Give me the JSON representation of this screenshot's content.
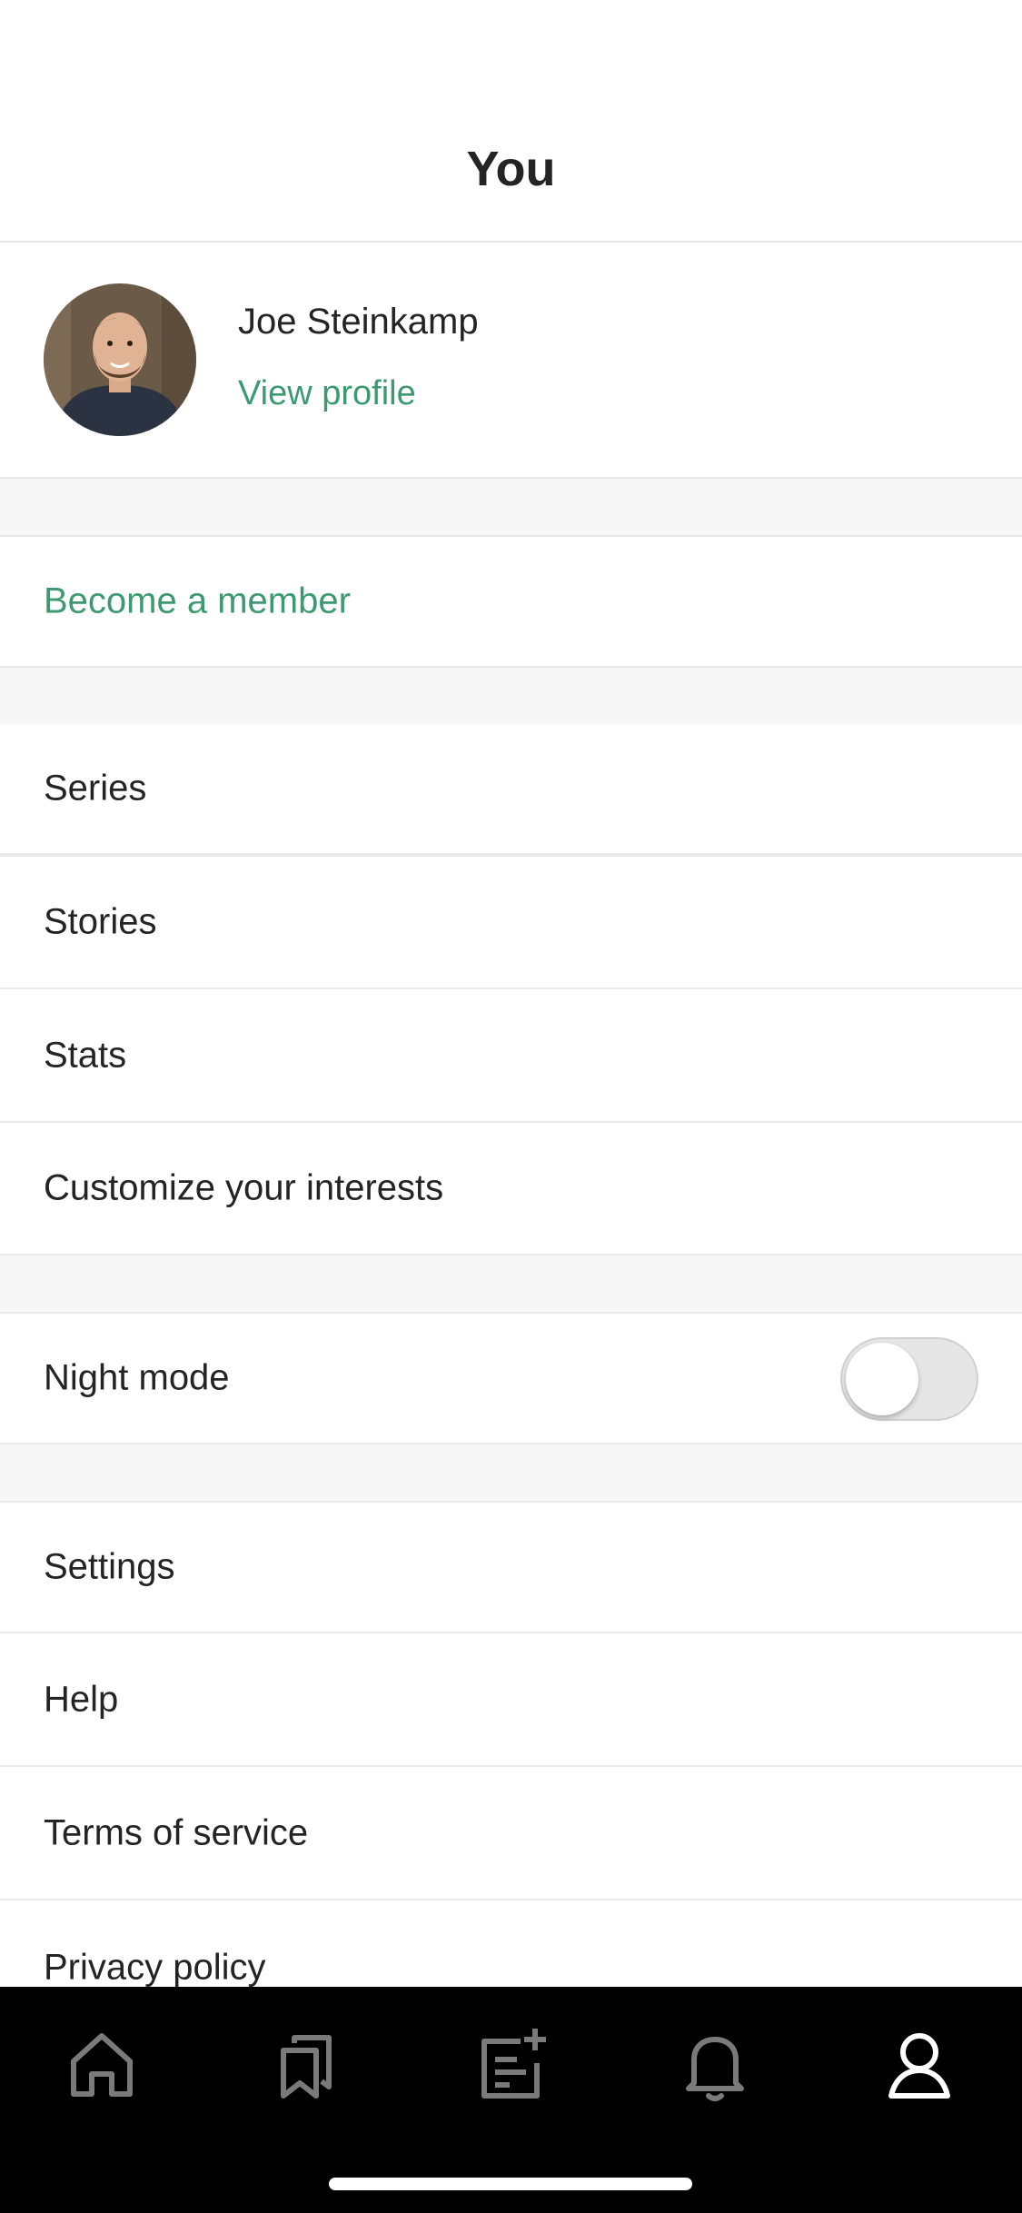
{
  "header": {
    "title": "You"
  },
  "profile": {
    "name": "Joe Steinkamp",
    "view_profile": "View profile",
    "avatar_icon": "avatar-photo"
  },
  "membership": {
    "label": "Become a member"
  },
  "menu": {
    "series": "Series",
    "stories": "Stories",
    "stats": "Stats",
    "interests": "Customize your interests",
    "night_mode": "Night mode",
    "night_mode_on": false,
    "settings": "Settings",
    "help": "Help",
    "terms": "Terms of service",
    "privacy": "Privacy policy"
  },
  "tabbar": {
    "tabs": [
      "home-icon",
      "bookmarks-icon",
      "write-icon",
      "bell-icon",
      "profile-icon"
    ],
    "active": "profile-icon"
  },
  "colors": {
    "accent": "#3d9a70",
    "text": "#242424",
    "tabbar_bg": "#000000",
    "tab_inactive": "#7a7a7a",
    "tab_active": "#ffffff"
  }
}
